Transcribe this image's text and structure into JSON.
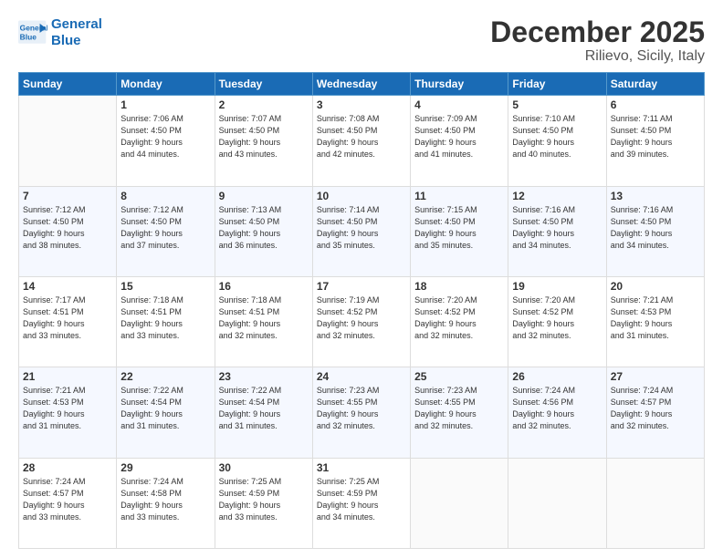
{
  "logo": {
    "line1": "General",
    "line2": "Blue"
  },
  "header": {
    "month": "December 2025",
    "location": "Rilievo, Sicily, Italy"
  },
  "weekdays": [
    "Sunday",
    "Monday",
    "Tuesday",
    "Wednesday",
    "Thursday",
    "Friday",
    "Saturday"
  ],
  "weeks": [
    [
      {
        "day": "",
        "info": ""
      },
      {
        "day": "1",
        "info": "Sunrise: 7:06 AM\nSunset: 4:50 PM\nDaylight: 9 hours\nand 44 minutes."
      },
      {
        "day": "2",
        "info": "Sunrise: 7:07 AM\nSunset: 4:50 PM\nDaylight: 9 hours\nand 43 minutes."
      },
      {
        "day": "3",
        "info": "Sunrise: 7:08 AM\nSunset: 4:50 PM\nDaylight: 9 hours\nand 42 minutes."
      },
      {
        "day": "4",
        "info": "Sunrise: 7:09 AM\nSunset: 4:50 PM\nDaylight: 9 hours\nand 41 minutes."
      },
      {
        "day": "5",
        "info": "Sunrise: 7:10 AM\nSunset: 4:50 PM\nDaylight: 9 hours\nand 40 minutes."
      },
      {
        "day": "6",
        "info": "Sunrise: 7:11 AM\nSunset: 4:50 PM\nDaylight: 9 hours\nand 39 minutes."
      }
    ],
    [
      {
        "day": "7",
        "info": "Sunrise: 7:12 AM\nSunset: 4:50 PM\nDaylight: 9 hours\nand 38 minutes."
      },
      {
        "day": "8",
        "info": "Sunrise: 7:12 AM\nSunset: 4:50 PM\nDaylight: 9 hours\nand 37 minutes."
      },
      {
        "day": "9",
        "info": "Sunrise: 7:13 AM\nSunset: 4:50 PM\nDaylight: 9 hours\nand 36 minutes."
      },
      {
        "day": "10",
        "info": "Sunrise: 7:14 AM\nSunset: 4:50 PM\nDaylight: 9 hours\nand 35 minutes."
      },
      {
        "day": "11",
        "info": "Sunrise: 7:15 AM\nSunset: 4:50 PM\nDaylight: 9 hours\nand 35 minutes."
      },
      {
        "day": "12",
        "info": "Sunrise: 7:16 AM\nSunset: 4:50 PM\nDaylight: 9 hours\nand 34 minutes."
      },
      {
        "day": "13",
        "info": "Sunrise: 7:16 AM\nSunset: 4:50 PM\nDaylight: 9 hours\nand 34 minutes."
      }
    ],
    [
      {
        "day": "14",
        "info": "Sunrise: 7:17 AM\nSunset: 4:51 PM\nDaylight: 9 hours\nand 33 minutes."
      },
      {
        "day": "15",
        "info": "Sunrise: 7:18 AM\nSunset: 4:51 PM\nDaylight: 9 hours\nand 33 minutes."
      },
      {
        "day": "16",
        "info": "Sunrise: 7:18 AM\nSunset: 4:51 PM\nDaylight: 9 hours\nand 32 minutes."
      },
      {
        "day": "17",
        "info": "Sunrise: 7:19 AM\nSunset: 4:52 PM\nDaylight: 9 hours\nand 32 minutes."
      },
      {
        "day": "18",
        "info": "Sunrise: 7:20 AM\nSunset: 4:52 PM\nDaylight: 9 hours\nand 32 minutes."
      },
      {
        "day": "19",
        "info": "Sunrise: 7:20 AM\nSunset: 4:52 PM\nDaylight: 9 hours\nand 32 minutes."
      },
      {
        "day": "20",
        "info": "Sunrise: 7:21 AM\nSunset: 4:53 PM\nDaylight: 9 hours\nand 31 minutes."
      }
    ],
    [
      {
        "day": "21",
        "info": "Sunrise: 7:21 AM\nSunset: 4:53 PM\nDaylight: 9 hours\nand 31 minutes."
      },
      {
        "day": "22",
        "info": "Sunrise: 7:22 AM\nSunset: 4:54 PM\nDaylight: 9 hours\nand 31 minutes."
      },
      {
        "day": "23",
        "info": "Sunrise: 7:22 AM\nSunset: 4:54 PM\nDaylight: 9 hours\nand 31 minutes."
      },
      {
        "day": "24",
        "info": "Sunrise: 7:23 AM\nSunset: 4:55 PM\nDaylight: 9 hours\nand 32 minutes."
      },
      {
        "day": "25",
        "info": "Sunrise: 7:23 AM\nSunset: 4:55 PM\nDaylight: 9 hours\nand 32 minutes."
      },
      {
        "day": "26",
        "info": "Sunrise: 7:24 AM\nSunset: 4:56 PM\nDaylight: 9 hours\nand 32 minutes."
      },
      {
        "day": "27",
        "info": "Sunrise: 7:24 AM\nSunset: 4:57 PM\nDaylight: 9 hours\nand 32 minutes."
      }
    ],
    [
      {
        "day": "28",
        "info": "Sunrise: 7:24 AM\nSunset: 4:57 PM\nDaylight: 9 hours\nand 33 minutes."
      },
      {
        "day": "29",
        "info": "Sunrise: 7:24 AM\nSunset: 4:58 PM\nDaylight: 9 hours\nand 33 minutes."
      },
      {
        "day": "30",
        "info": "Sunrise: 7:25 AM\nSunset: 4:59 PM\nDaylight: 9 hours\nand 33 minutes."
      },
      {
        "day": "31",
        "info": "Sunrise: 7:25 AM\nSunset: 4:59 PM\nDaylight: 9 hours\nand 34 minutes."
      },
      {
        "day": "",
        "info": ""
      },
      {
        "day": "",
        "info": ""
      },
      {
        "day": "",
        "info": ""
      }
    ]
  ]
}
